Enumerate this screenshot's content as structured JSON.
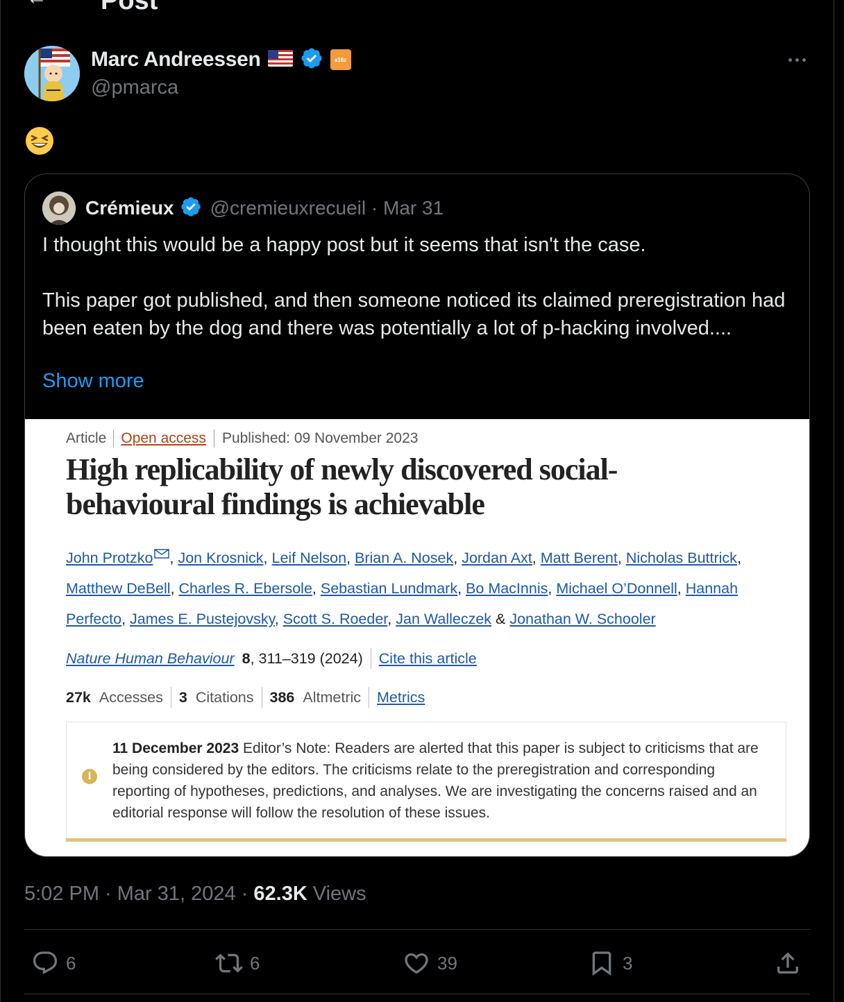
{
  "header": {
    "title": "Post"
  },
  "post": {
    "author": {
      "name": "Marc Andreessen",
      "handle": "@pmarca",
      "badge_text": "a16z"
    },
    "text_emoji": "😆",
    "timestamp": "5:02 PM · Mar 31, 2024 ·",
    "views_count": "62.3K",
    "views_label": "Views",
    "actions": {
      "replies": "6",
      "reposts": "6",
      "likes": "39",
      "bookmarks": "3"
    }
  },
  "quote": {
    "author_name": "Crémieux",
    "author_handle": "@cremieuxrecueil · Mar 31",
    "text_line1": "I thought this would be a happy post but it seems that isn't the case.",
    "text_line2": "This paper got published, and then someone noticed its claimed preregistration had been eaten by the dog and there was potentially a lot of p-hacking involved....",
    "show_more": "Show more",
    "article": {
      "type": "Article",
      "access": "Open access",
      "published": "Published: 09 November 2023",
      "title": "High replicability of newly discovered social-behavioural findings is achievable",
      "authors": [
        "John Protzko",
        "Jon Krosnick",
        "Leif Nelson",
        "Brian A. Nosek",
        "Jordan Axt",
        "Matt Berent",
        "Nicholas Buttrick",
        "Matthew DeBell",
        "Charles R. Ebersole",
        "Sebastian Lundmark",
        "Bo MacInnis",
        "Michael O’Donnell",
        "Hannah Perfecto",
        "James E. Pustejovsky",
        "Scott S. Roeder",
        "Jan Walleczek",
        "Jonathan W. Schooler"
      ],
      "journal": "Nature Human Behaviour",
      "volume": "8",
      "pages_year": ", 311–319 (2024)",
      "cite_label": "Cite this article",
      "accesses_num": "27k",
      "accesses_label": "Accesses",
      "citations_num": "3",
      "citations_label": "Citations",
      "altmetric_num": "386",
      "altmetric_label": "Altmetric",
      "metrics_label": "Metrics",
      "note_date": "11 December 2023",
      "note_text": "Editor’s Note: Readers are alerted that this paper is subject to criticisms that are being considered by the editors. The criticisms relate to the preregistration and corresponding reporting of hypotheses, predictions, and analyses. We are investigating the concerns raised and an editorial response will follow the resolution of these issues."
    }
  },
  "colors": {
    "accent": "#1d9bf0",
    "verified": "#1d9bf0",
    "muted": "#71767b",
    "link": "#1f58a8"
  }
}
